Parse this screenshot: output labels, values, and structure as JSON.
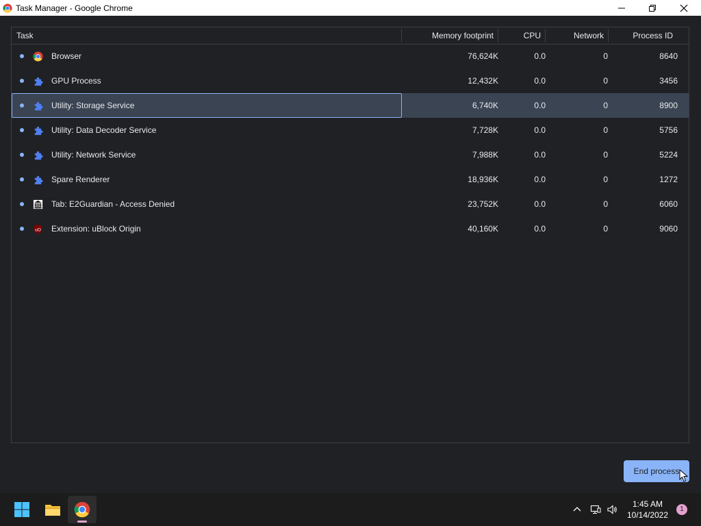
{
  "window": {
    "title": "Task Manager - Google Chrome"
  },
  "table": {
    "columns": [
      "Task",
      "Memory footprint",
      "CPU",
      "Network",
      "Process ID"
    ],
    "rows": [
      {
        "task": "Browser",
        "memory": "76,624K",
        "cpu": "0.0",
        "network": "0",
        "pid": "8640",
        "icon": "chrome-icon"
      },
      {
        "task": "GPU Process",
        "memory": "12,432K",
        "cpu": "0.0",
        "network": "0",
        "pid": "3456",
        "icon": "puzzle-icon"
      },
      {
        "task": "Utility: Storage Service",
        "memory": "6,740K",
        "cpu": "0.0",
        "network": "0",
        "pid": "8900",
        "icon": "puzzle-icon"
      },
      {
        "task": "Utility: Data Decoder Service",
        "memory": "7,728K",
        "cpu": "0.0",
        "network": "0",
        "pid": "5756",
        "icon": "puzzle-icon"
      },
      {
        "task": "Utility: Network Service",
        "memory": "7,988K",
        "cpu": "0.0",
        "network": "0",
        "pid": "5224",
        "icon": "puzzle-icon"
      },
      {
        "task": "Spare Renderer",
        "memory": "18,936K",
        "cpu": "0.0",
        "network": "0",
        "pid": "1272",
        "icon": "puzzle-icon"
      },
      {
        "task": "Tab: E2Guardian - Access Denied",
        "memory": "23,752K",
        "cpu": "0.0",
        "network": "0",
        "pid": "6060",
        "icon": "building-icon"
      },
      {
        "task": "Extension: uBlock Origin",
        "memory": "40,160K",
        "cpu": "0.0",
        "network": "0",
        "pid": "9060",
        "icon": "ublock-icon"
      }
    ],
    "selected_task": "Utility: Storage Service"
  },
  "actions": {
    "end_process_label": "End process"
  },
  "taskbar": {
    "time": "1:45 AM",
    "date": "10/14/2022",
    "notification_count": "1"
  },
  "colors": {
    "background": "#202124",
    "accent": "#8ab4f8",
    "selected_row": "#3b4453"
  }
}
